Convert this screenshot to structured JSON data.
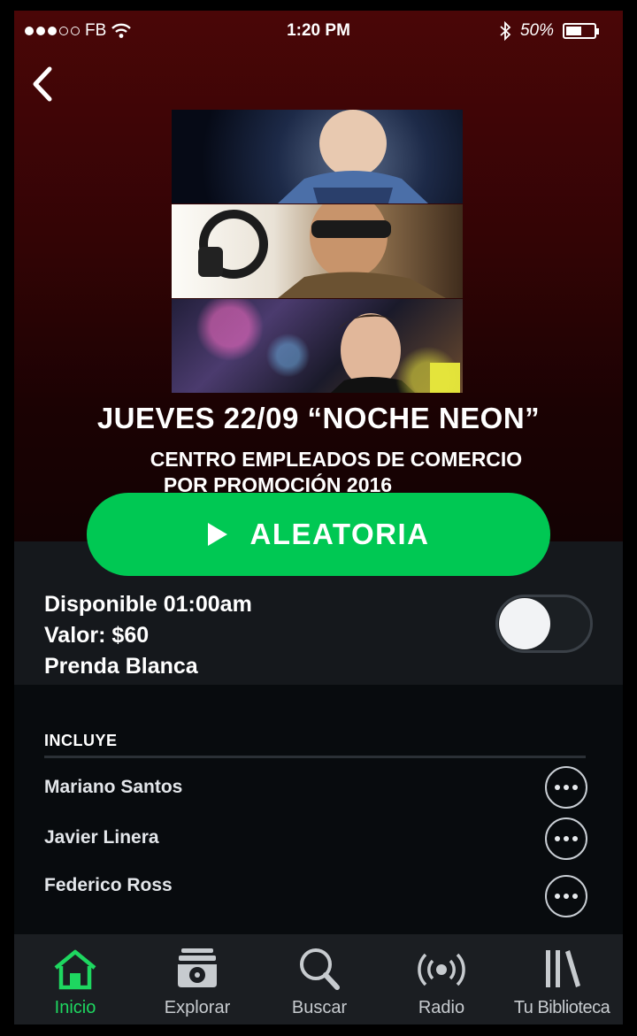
{
  "status_bar": {
    "carrier": "FB",
    "time": "1:20 PM",
    "battery_percent": "50%"
  },
  "event": {
    "title": "JUEVES 22/09 “NOCHE NEON”",
    "subtitle_line1": "CENTRO EMPLEADOS DE COMERCIO",
    "subtitle_line2": "POR PROMOCIÓN 2016"
  },
  "play_button": {
    "label": "ALEATORIA",
    "color": "#00c853"
  },
  "details": {
    "available": "Disponible  01:00am",
    "price": "Valor: $60",
    "dress": "Prenda Blanca",
    "toggle_on": false
  },
  "includes": {
    "header": "INCLUYE",
    "items": [
      "Mariano Santos",
      "Javier Linera",
      "Federico Ross"
    ]
  },
  "tabs": [
    {
      "label": "Inicio",
      "icon": "home-icon",
      "active": true
    },
    {
      "label": "Explorar",
      "icon": "browse-icon",
      "active": false
    },
    {
      "label": "Buscar",
      "icon": "search-icon",
      "active": false
    },
    {
      "label": "Radio",
      "icon": "radio-icon",
      "active": false
    },
    {
      "label": "Tu Biblioteca",
      "icon": "library-icon",
      "active": false
    }
  ],
  "colors": {
    "accent": "#1ed760",
    "hero_top": "#4a0607",
    "background": "#0b0d0f"
  }
}
